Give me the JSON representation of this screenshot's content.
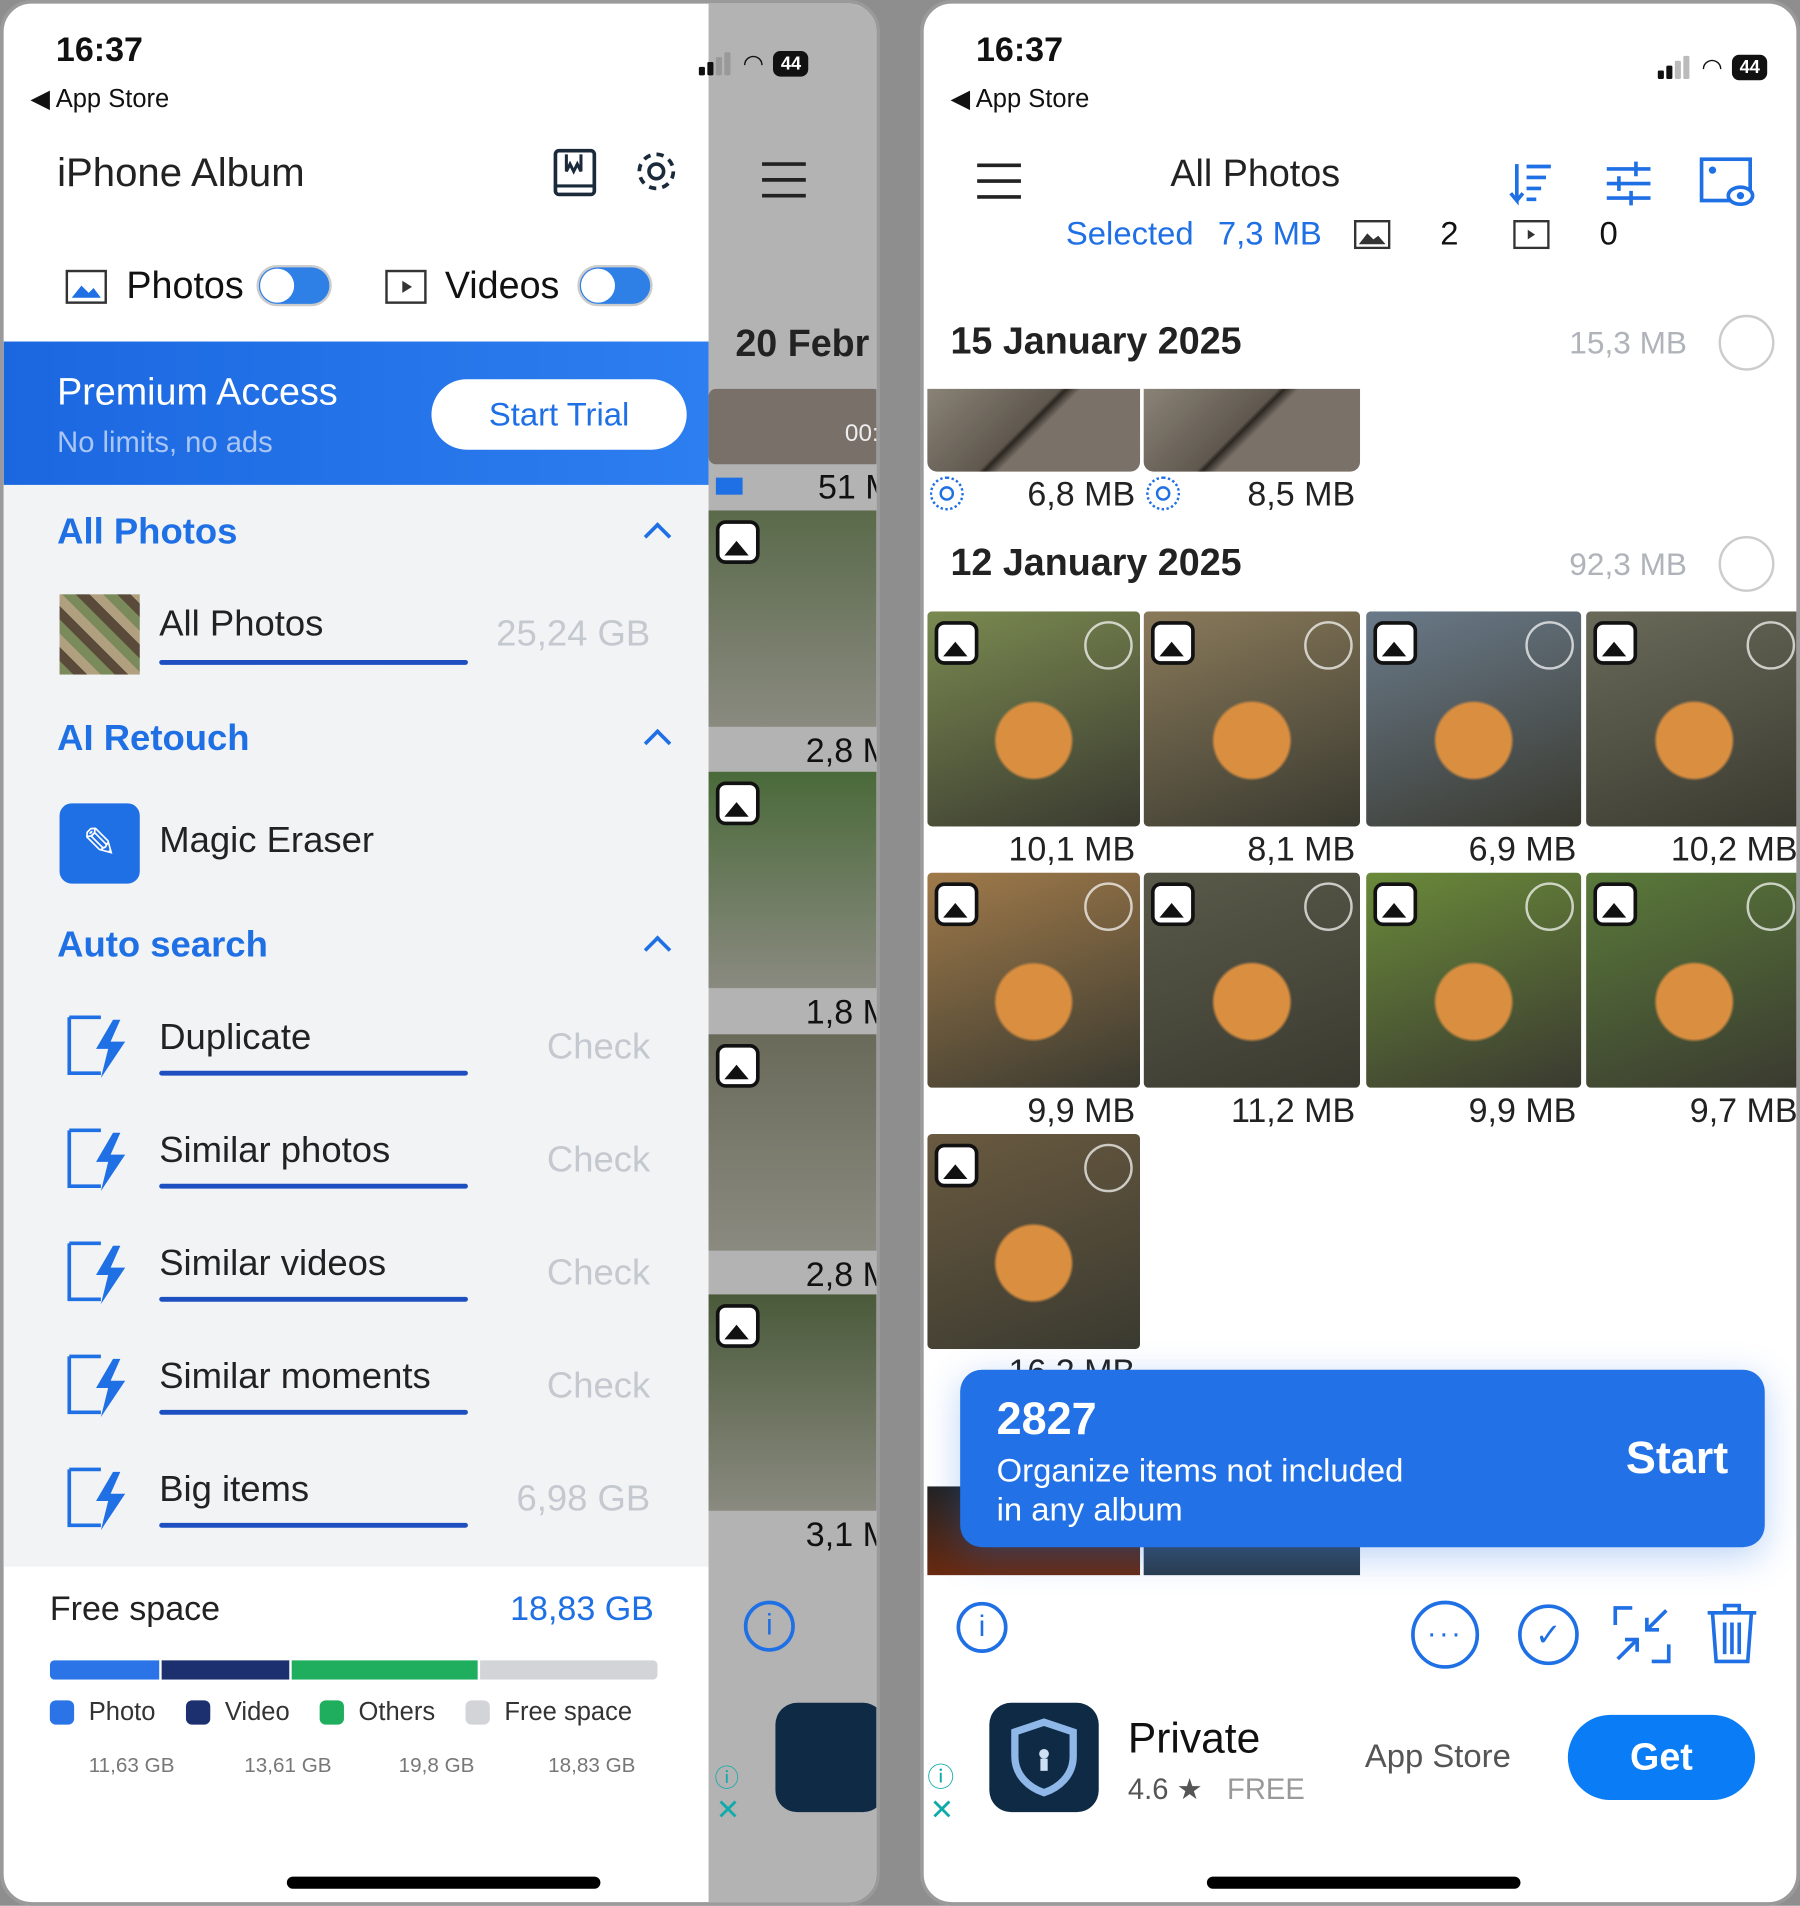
{
  "status": {
    "time": "16:37",
    "back": "App Store",
    "battery": "44"
  },
  "left": {
    "title": "iPhone Album",
    "icons": [
      "bookmark-book-icon",
      "gear-icon"
    ],
    "toggles": [
      {
        "label": "Photos",
        "on": true
      },
      {
        "label": "Videos",
        "on": true
      }
    ],
    "premium": {
      "title": "Premium Access",
      "subtitle": "No limits, no ads",
      "button": "Start Trial"
    },
    "all_photos": {
      "header": "All Photos",
      "item": "All Photos",
      "size": "25,24 GB"
    },
    "ai_retouch": {
      "header": "AI Retouch",
      "item": "Magic Eraser"
    },
    "auto_search": {
      "header": "Auto search",
      "items": [
        {
          "label": "Duplicate",
          "value": "Check"
        },
        {
          "label": "Similar photos",
          "value": "Check"
        },
        {
          "label": "Similar videos",
          "value": "Check"
        },
        {
          "label": "Similar moments",
          "value": "Check"
        },
        {
          "label": "Big items",
          "value": "6,98 GB"
        }
      ]
    },
    "storage": {
      "title": "Free space",
      "value": "18,83 GB",
      "segments": [
        {
          "label": "Photo",
          "value": "11,63 GB",
          "gb": 11.63,
          "color": "#2a74e8"
        },
        {
          "label": "Video",
          "value": "13,61 GB",
          "gb": 13.61,
          "color": "#1c2f6e"
        },
        {
          "label": "Others",
          "value": "19,8 GB",
          "gb": 19.8,
          "color": "#1fae5e"
        },
        {
          "label": "Free space",
          "value": "18,83 GB",
          "gb": 18.83,
          "color": "#d3d4d8"
        }
      ]
    },
    "behind": {
      "date": "20 Febr",
      "duration": "00:",
      "sizes": [
        "51 M",
        "2,8 M",
        "1,8 M",
        "2,8 M",
        "3,1 M"
      ]
    }
  },
  "right": {
    "title": "All Photos",
    "selected_label": "Selected",
    "selected_size": "7,3 MB",
    "photo_count": "2",
    "video_count": "0",
    "groups": [
      {
        "date": "15 January 2025",
        "size": "15,3 MB",
        "items": [
          "6,8 MB",
          "8,5 MB"
        ]
      },
      {
        "date": "12 January 2025",
        "size": "92,3 MB",
        "items": [
          "10,1 MB",
          "8,1 MB",
          "6,9 MB",
          "10,2 MB",
          "9,9 MB",
          "11,2 MB",
          "9,9 MB",
          "9,7 MB",
          "16,2 MB"
        ]
      }
    ],
    "banner": {
      "count": "2827",
      "text1": "Organize items not included",
      "text2": "in any album",
      "button": "Start"
    },
    "ad": {
      "name": "Private",
      "rating": "4.6",
      "star": "★",
      "price": "FREE",
      "store": "App Store",
      "button": "Get"
    }
  },
  "colors": {
    "accent": "#1f6fe5",
    "banner": "#2271e6",
    "get": "#0a7cf5"
  }
}
